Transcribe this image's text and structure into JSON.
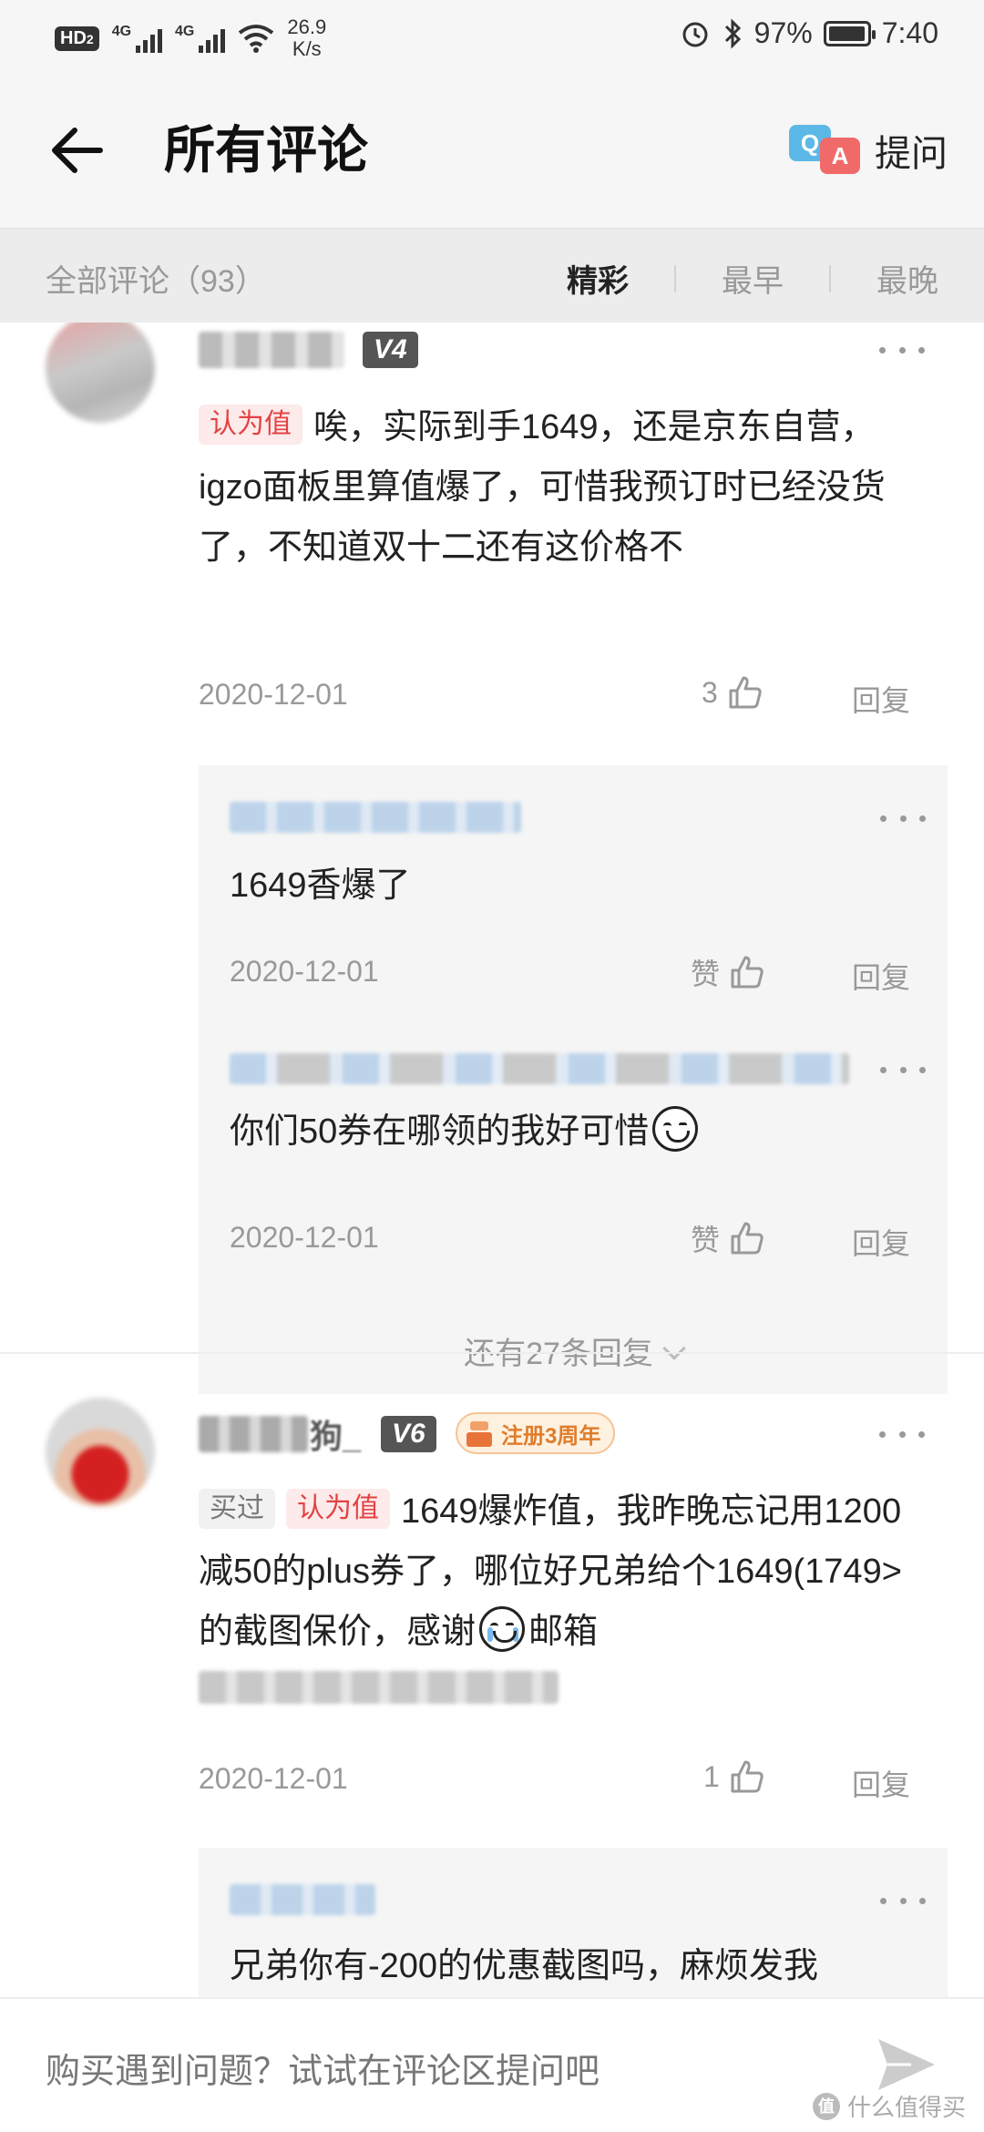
{
  "status_bar": {
    "hd": "HD",
    "hd_sub": "2",
    "net1": "4G",
    "net2": "4G",
    "speed_value": "26.9",
    "speed_unit": "K/s",
    "battery": "97%",
    "time": "7:40",
    "battery_level": 0.97
  },
  "header": {
    "title": "所有评论",
    "ask_label": "提问",
    "qa_q": "Q",
    "qa_a": "A"
  },
  "filter": {
    "all_label": "全部评论（93）",
    "tabs": [
      "精彩",
      "最早",
      "最晚"
    ],
    "active_tab": "精彩"
  },
  "comments": [
    {
      "level": "V4",
      "tags": [
        "认为值"
      ],
      "text": "唉，实际到手1649，还是京东自营，igzo面板里算值爆了，可惜我预订时已经没货了，不知道双十二还有这价格不",
      "date": "2020-12-01",
      "likes": "3",
      "reply_label": "回复",
      "replies": [
        {
          "text": "1649香爆了",
          "date": "2020-12-01",
          "like_label": "赞",
          "reply_label": "回复"
        },
        {
          "text": "你们50券在哪领的我好可惜",
          "date": "2020-12-01",
          "like_label": "赞",
          "reply_label": "回复"
        }
      ],
      "more_replies": "还有27条回复"
    },
    {
      "name_suffix": "狗_",
      "level": "V6",
      "anniversary": "注册3周年",
      "tags": [
        "买过",
        "认为值"
      ],
      "text_a": "1649爆炸值，我昨晚忘记用1200减50的plus券了，哪位好兄弟给个1649(1749>的截图保价，感谢",
      "text_b": "邮箱",
      "date": "2020-12-01",
      "likes": "1",
      "reply_label": "回复",
      "replies": [
        {
          "text": "兄弟你有-200的优惠截图吗，麻烦发我"
        }
      ]
    }
  ],
  "bottom": {
    "placeholder": "购买遇到问题？试试在评论区提问吧",
    "watermark": "什么值得买",
    "watermark_icon": "值"
  }
}
